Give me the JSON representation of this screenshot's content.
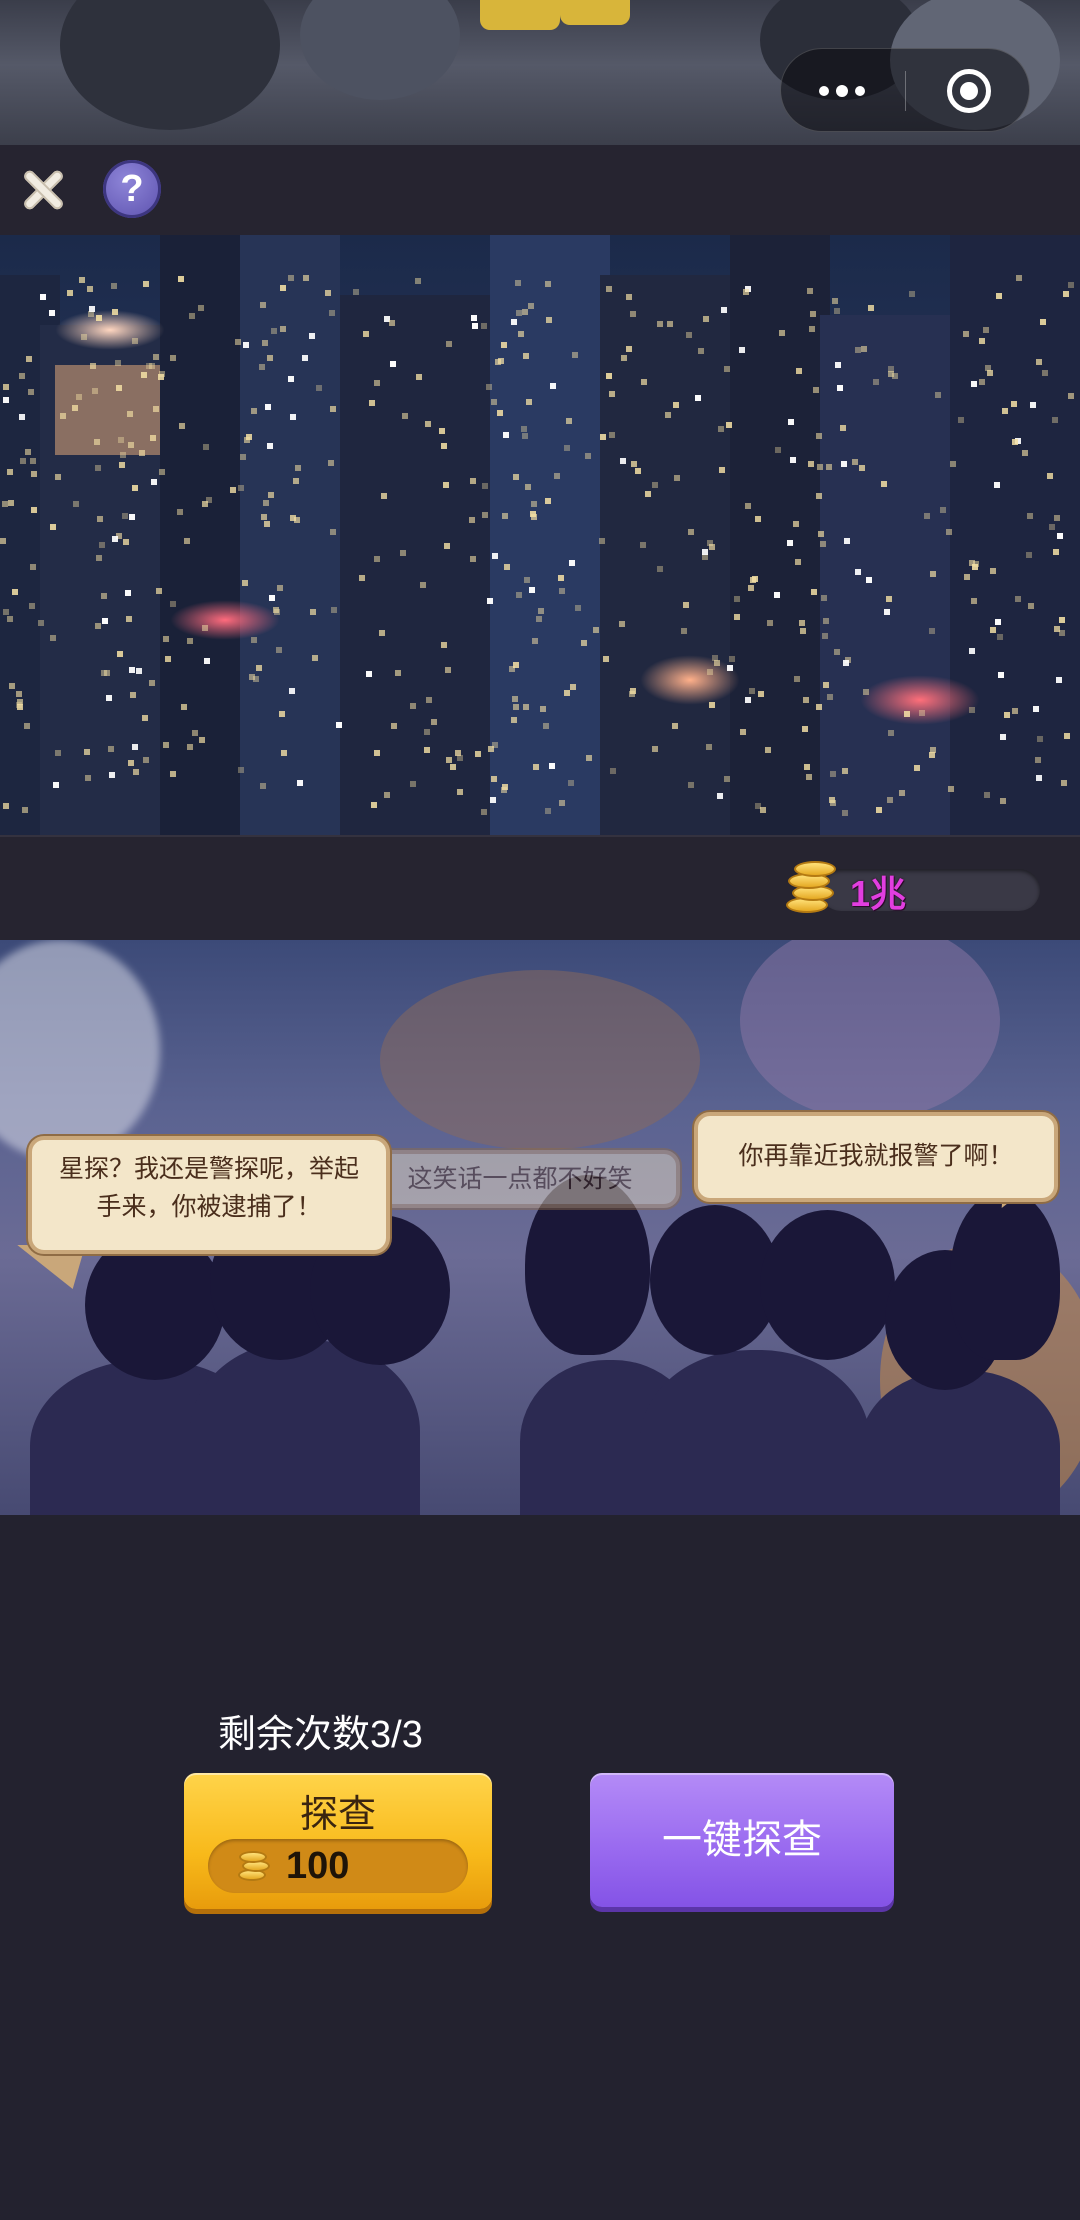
{
  "window": {
    "capsule": {
      "more_icon": "more-dots-icon",
      "close_icon": "mini-program-close-icon"
    }
  },
  "toolbar": {
    "close_icon": "close-x-icon",
    "help_label": "?"
  },
  "resources": {
    "coin_icon": "gold-coins-icon",
    "coin_amount": "1兆"
  },
  "speech_bubbles": {
    "left": "星探？我还是警探呢，举起手来，你被逮捕了！",
    "middle": "这笑话一点都不好笑",
    "right": "你再靠近我就报警了啊！"
  },
  "actions": {
    "remaining": "剩余次数3/3",
    "probe_label": "探查",
    "probe_cost": "100",
    "one_key_label": "一键探查"
  },
  "colors": {
    "coin_text": "#e23ee0",
    "probe_button": "#f8b91a",
    "one_key_button": "#9a6bf0",
    "panel_bg": "#23222f"
  }
}
